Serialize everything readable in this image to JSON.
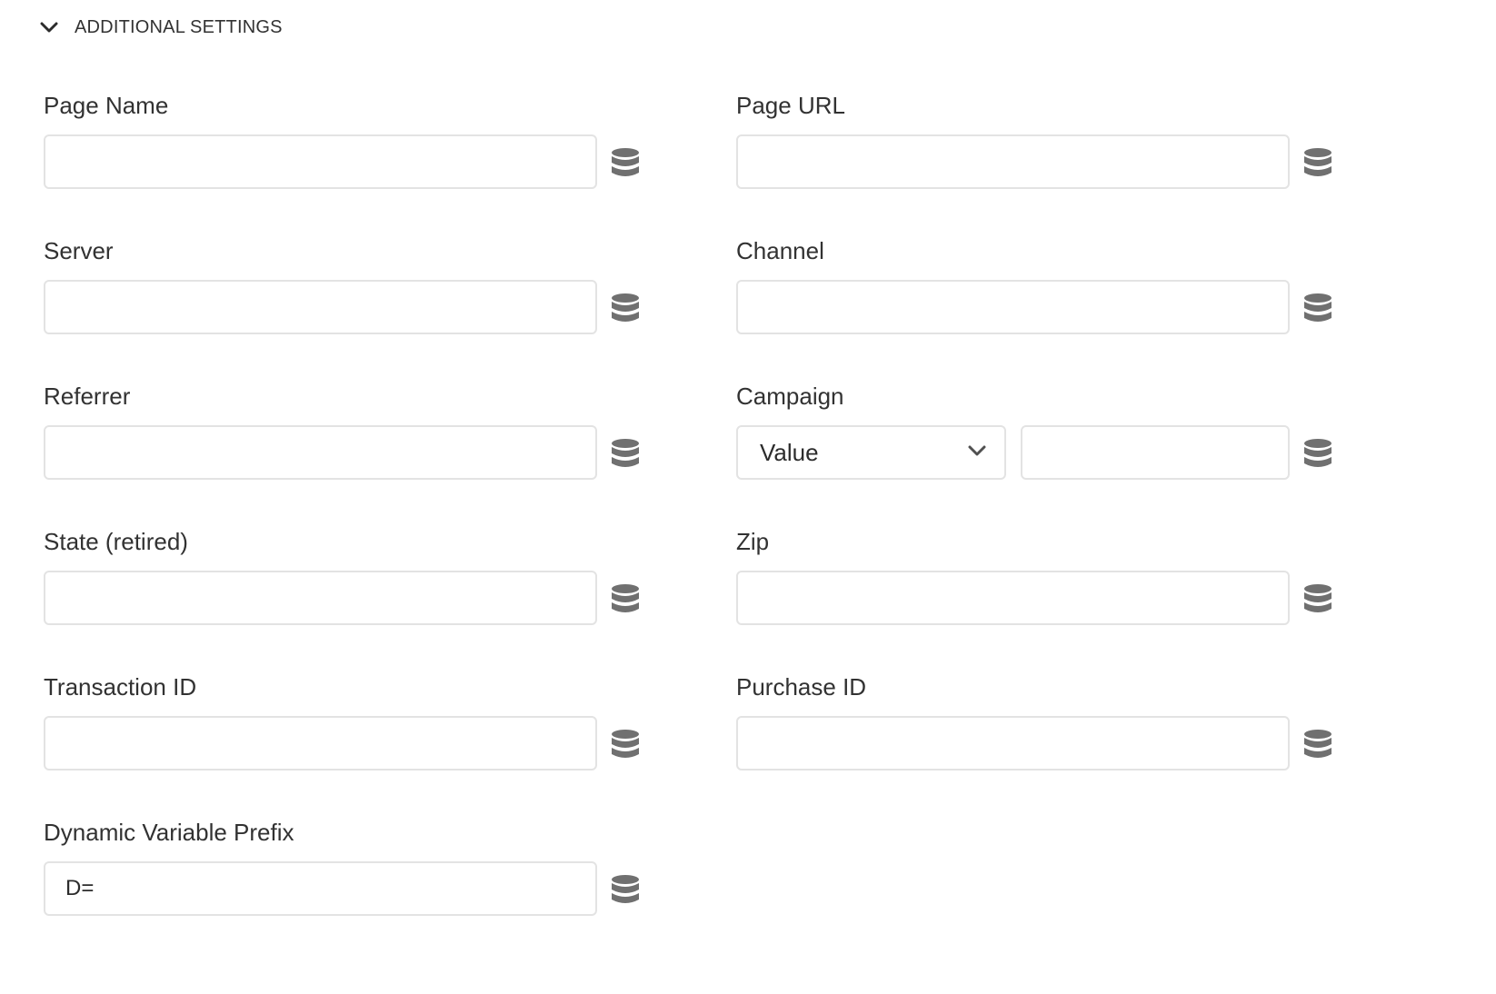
{
  "section": {
    "title": "ADDITIONAL SETTINGS",
    "expand_icon": "chevron-down-icon"
  },
  "icons": {
    "data_element": "database-icon",
    "dropdown": "chevron-down-icon"
  },
  "colors": {
    "icon": "#707070",
    "border": "#e3e3e3",
    "text": "#323232"
  },
  "fields": {
    "page_name": {
      "label": "Page Name",
      "value": ""
    },
    "page_url": {
      "label": "Page URL",
      "value": ""
    },
    "server": {
      "label": "Server",
      "value": ""
    },
    "channel": {
      "label": "Channel",
      "value": ""
    },
    "referrer": {
      "label": "Referrer",
      "value": ""
    },
    "campaign": {
      "label": "Campaign",
      "select_value": "Value",
      "value": ""
    },
    "state": {
      "label": "State (retired)",
      "value": ""
    },
    "zip": {
      "label": "Zip",
      "value": ""
    },
    "transaction_id": {
      "label": "Transaction ID",
      "value": ""
    },
    "purchase_id": {
      "label": "Purchase ID",
      "value": ""
    },
    "dynamic_prefix": {
      "label": "Dynamic Variable Prefix",
      "value": "D="
    }
  }
}
